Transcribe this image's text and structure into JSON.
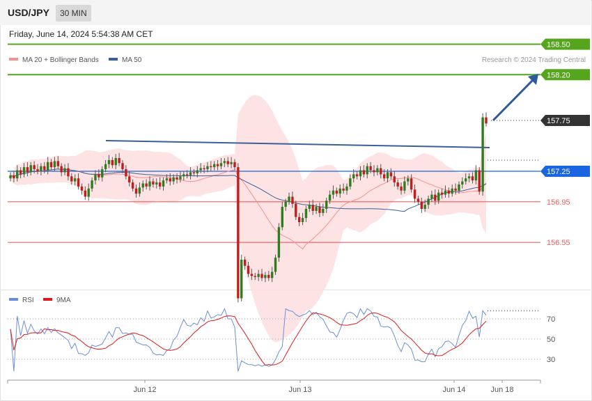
{
  "header": {
    "symbol": "USD/JPY",
    "timeframe": "30 MIN"
  },
  "datetime": "Friday, June 14, 2024 5:54:38 AM CET",
  "legend": {
    "ma20_label": "MA 20 + Bollinger Bands",
    "ma50_label": "MA 50",
    "rsi_label": "RSI",
    "rsi_ma_label": "9MA"
  },
  "credit": "Research © 2024 Trading Central",
  "colors": {
    "resistance": "#55a61c",
    "support": "#f25b5b",
    "current": "#333333",
    "pivot": "#1a66e0",
    "ma20": "#f79090",
    "ma50": "#3a5f99",
    "bull": "#2f7d1f",
    "bear": "#c21d1d",
    "band": "#fde0e0",
    "rsi": "#6a8fd8",
    "rsi_ma": "#e01a1a",
    "arrow": "#2e5a9c"
  },
  "chart_data": {
    "type": "candlestick",
    "instrument": "USD/JPY",
    "interval": "30 MIN",
    "price_levels": [
      {
        "label": "158.50",
        "price": 158.5,
        "kind": "resistance"
      },
      {
        "label": "158.20",
        "price": 158.2,
        "kind": "resistance"
      },
      {
        "label": "157.75",
        "price": 157.75,
        "kind": "current"
      },
      {
        "label": "157.25",
        "price": 157.25,
        "kind": "pivot"
      },
      {
        "label": "156.95",
        "price": 156.95,
        "kind": "support"
      },
      {
        "label": "156.55",
        "price": 156.55,
        "kind": "support"
      }
    ],
    "x_axis_labels": [
      "Jun 12",
      "Jun 13",
      "Jun 14",
      "Jun 18"
    ],
    "closes": [
      157.21,
      157.18,
      157.26,
      157.22,
      157.29,
      157.24,
      157.31,
      157.27,
      157.25,
      157.3,
      157.26,
      157.34,
      157.29,
      157.35,
      157.3,
      157.24,
      157.28,
      157.2,
      157.15,
      157.18,
      157.1,
      157.06,
      157.0,
      157.08,
      157.16,
      157.22,
      157.19,
      157.27,
      157.32,
      157.36,
      157.31,
      157.38,
      157.33,
      157.27,
      157.2,
      157.14,
      157.08,
      157.03,
      157.09,
      157.13,
      157.1,
      157.15,
      157.12,
      157.14,
      157.1,
      157.16,
      157.18,
      157.15,
      157.19,
      157.17,
      157.2,
      157.22,
      157.21,
      157.24,
      157.23,
      157.26,
      157.28,
      157.27,
      157.3,
      157.29,
      157.32,
      157.3,
      157.33,
      157.35,
      157.32,
      157.34,
      157.29,
      156.0,
      156.38,
      156.32,
      156.24,
      156.22,
      156.21,
      156.24,
      156.2,
      156.23,
      156.2,
      156.26,
      156.4,
      156.7,
      156.9,
      156.95,
      157.0,
      156.93,
      156.8,
      156.75,
      156.79,
      156.88,
      156.92,
      156.86,
      156.9,
      156.84,
      156.88,
      156.96,
      157.02,
      157.06,
      157.03,
      157.08,
      157.06,
      157.1,
      157.18,
      157.22,
      157.2,
      157.26,
      157.22,
      157.3,
      157.26,
      157.24,
      157.28,
      157.22,
      157.18,
      157.24,
      157.2,
      157.14,
      157.1,
      157.06,
      157.15,
      157.18,
      157.07,
      156.98,
      156.95,
      156.88,
      156.92,
      156.98,
      157.02,
      156.96,
      157.04,
      157.02,
      157.06,
      157.03,
      157.08,
      157.06,
      157.12,
      157.15,
      157.18,
      157.2,
      157.16,
      157.26,
      157.05,
      157.78,
      157.72
    ],
    "rsi": {
      "ticks": [
        70,
        50,
        30
      ],
      "last_value": 78,
      "last_ma_value": 66
    }
  }
}
